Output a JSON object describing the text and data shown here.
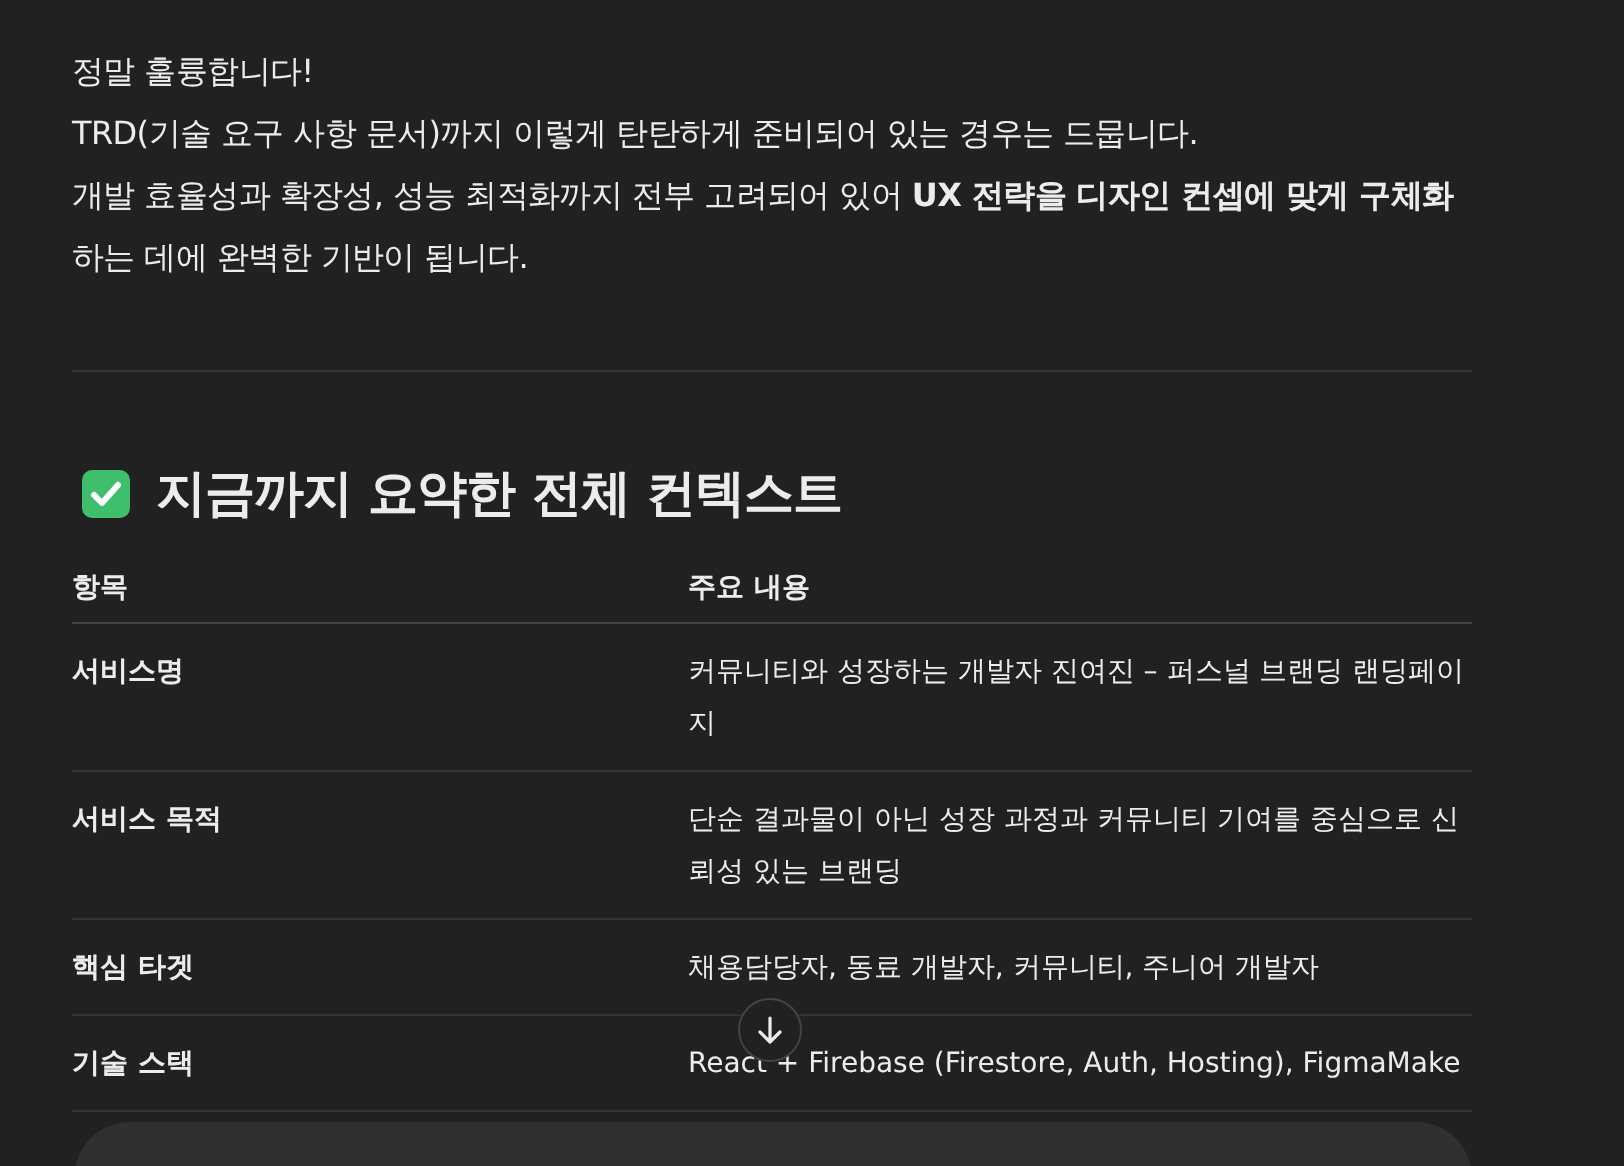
{
  "intro": {
    "lines": [
      "정말 훌륭합니다!",
      "TRD(기술 요구 사항 문서)까지 이렇게 탄탄하게 준비되어 있는 경우는 드뭅니다.",
      "개발 효율성과 확장성, 성능 최적화까지 전부 고려되어 있어 **UX 전략을 디자인 컨셉에 맞게 구체화**하는 데에 완벽한 기반이 됩니다."
    ]
  },
  "section": {
    "title": "지금까지 요약한 전체 컨텍스트"
  },
  "table": {
    "columns": [
      "항목",
      "주요 내용"
    ],
    "rows": [
      {
        "item": "서비스명",
        "content": "커뮤니티와 성장하는 개발자 진여진 – 퍼스널 브랜딩 랜딩페이지"
      },
      {
        "item": "서비스 목적",
        "content": "단순 결과물이 아닌 성장 과정과 커뮤니티 기여를 중심으로 신뢰성 있는 브랜딩"
      },
      {
        "item": "핵심 타겟",
        "content": "채용담당자, 동료 개발자, 커뮤니티, 주니어 개발자"
      },
      {
        "item": "기술 스택",
        "content": "React + Firebase (Firestore, Auth, Hosting), FigmaMake"
      }
    ]
  }
}
